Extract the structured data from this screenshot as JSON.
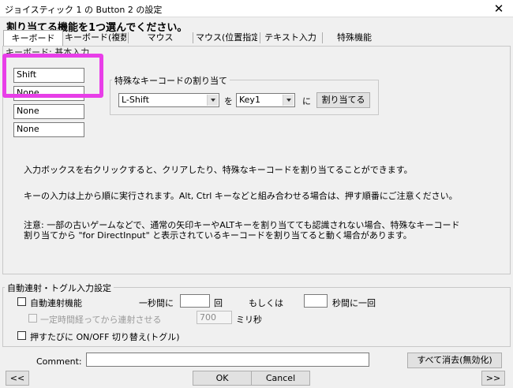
{
  "window": {
    "title": "ジョイスティック 1 の Button 2 の設定",
    "close_glyph": "✕"
  },
  "heading": "割り当てる機能を1つ選んでください。",
  "tabs": [
    {
      "label": "キーボード"
    },
    {
      "label": "キーボード(複数"
    },
    {
      "label": "マウス"
    },
    {
      "label": "マウス(位置指定"
    },
    {
      "label": "テキスト入力"
    },
    {
      "label": "特殊機能"
    }
  ],
  "keyboard_panel": {
    "caption": "キーボード: 基本入力",
    "key_inputs": [
      "Shift",
      "None",
      "None",
      "None"
    ]
  },
  "special_key": {
    "caption": "特殊なキーコードの割り当て",
    "source_select": "L-Shift",
    "wo_label": "を",
    "target_select": "Key1",
    "ni_label": "に",
    "assign_button": "割り当てる"
  },
  "info_texts": {
    "line1": "入力ボックスを右クリックすると、クリアしたり、特殊なキーコードを割り当てることができます。",
    "line2": "キーの入力は上から順に実行されます。Alt, Ctrl キーなどと組み合わせる場合は、押す順番にご注意ください。",
    "note1": "注意: 一部の古いゲームなどで、通常の矢印キーやALTキーを割り当てても認識されない場合、特殊なキーコード",
    "note2": "割り当てから \"for DirectInput\" と表示されているキーコードを割り当てると動く場合があります。"
  },
  "autofire": {
    "caption": "自動連射・トグル入力設定",
    "autofire_label": "自動連射機能",
    "per_second_label": "一秒間に",
    "per_second_value": "",
    "times_unit": "回",
    "or_label": "もしくは",
    "interval_value": "",
    "interval_unit": "秒間に一回",
    "delay_label": "一定時間経ってから連射させる",
    "delay_value": "700",
    "ms_unit": "ミリ秒",
    "toggle_label": "押すたびに ON/OFF 切り替え(トグル)"
  },
  "bottom": {
    "comment_label": "Comment:",
    "comment_value": "",
    "clear_all_button": "すべて消去(無効化)",
    "prev_button": "<<",
    "ok_button": "OK",
    "cancel_button": "Cancel",
    "next_button": ">>"
  },
  "colors": {
    "highlight": "#e83ee8"
  }
}
